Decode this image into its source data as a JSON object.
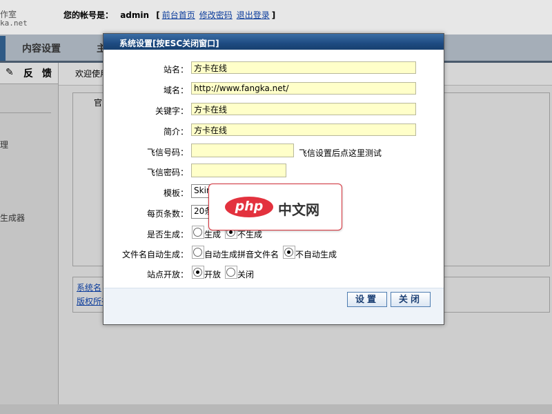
{
  "header": {
    "brand_line1": "作室",
    "brand_line2": "ka.net",
    "account_label": "您的帐号是：",
    "username": "admin",
    "bracket_open": "[",
    "links": [
      "前台首页",
      "修改密码",
      "退出登录"
    ],
    "bracket_close": "]"
  },
  "nav": {
    "tabs": [
      "内容设置",
      "主"
    ]
  },
  "sidebar": {
    "feedback_label": "反 馈",
    "items": [
      "理",
      "生成器"
    ]
  },
  "main": {
    "welcome": "欢迎使用",
    "panel_title": "官",
    "info_links": [
      "系统名",
      "版权所有"
    ]
  },
  "dialog": {
    "title": "系统设置[按ESC关闭窗口]",
    "fields": {
      "site_name": {
        "label": "站名：",
        "value": "方卡在线"
      },
      "domain": {
        "label": "域名：",
        "value": "http://www.fangka.net/"
      },
      "keywords": {
        "label": "关键字：",
        "value": "方卡在线"
      },
      "intro": {
        "label": "简介：",
        "value": "方卡在线"
      },
      "fetion_number": {
        "label": "飞信号码：",
        "value": "",
        "hint": "飞信设置后点这里测试"
      },
      "fetion_password": {
        "label": "飞信密码：",
        "value": ""
      },
      "template": {
        "label": "模板：",
        "value": "Skin"
      },
      "per_page": {
        "label": "每页条数：",
        "value": "20条"
      }
    },
    "radios": {
      "generate": {
        "label": "是否生成：",
        "options": [
          "生成",
          "不生成"
        ],
        "selected": "不生成"
      },
      "filename_auto": {
        "label": "文件名自动生成：",
        "options": [
          "自动生成拼音文件名",
          "不自动生成"
        ],
        "selected": "不自动生成"
      },
      "site_open": {
        "label": "站点开放：",
        "options": [
          "开放",
          "关闭"
        ],
        "selected": "开放"
      }
    },
    "buttons": {
      "save": "设置",
      "close": "关闭"
    }
  },
  "watermark": {
    "logo_text": "php",
    "logo_cn": "中文网"
  },
  "colors": {
    "title_bar": "#1e4b82",
    "field_bg": "#ffffc9",
    "link": "#0b3c9c",
    "logo_red": "#e3323e"
  }
}
